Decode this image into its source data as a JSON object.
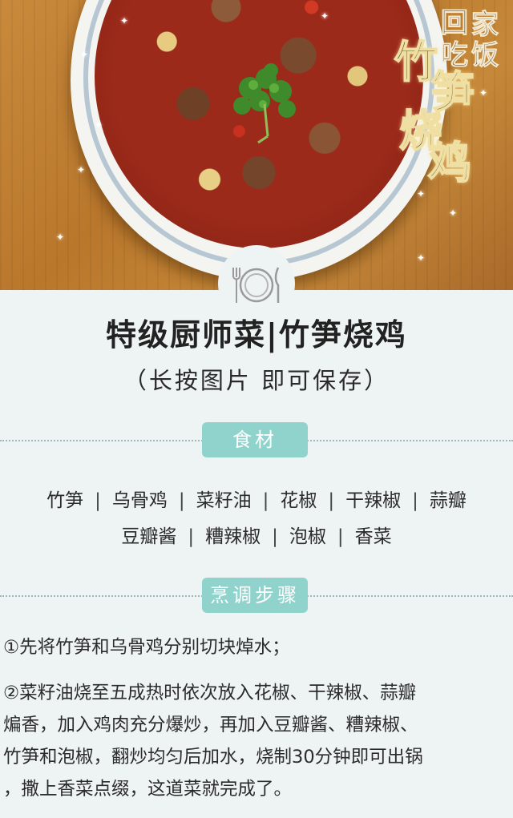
{
  "logo": {
    "chars": [
      "回",
      "家",
      "吃",
      "饭"
    ]
  },
  "hero_title": [
    "竹",
    "笋",
    "烧",
    "鸡"
  ],
  "page": {
    "title": "特级厨师菜|竹笋烧鸡",
    "subtitle": "（长按图片  即可保存）"
  },
  "ingredients": {
    "label": "食材",
    "row1": [
      "竹笋",
      "乌骨鸡",
      "菜籽油",
      "花椒",
      "干辣椒",
      "蒜瓣"
    ],
    "row2": [
      "豆瓣酱",
      "糟辣椒",
      "泡椒",
      "香菜"
    ]
  },
  "steps": {
    "label": "烹调步骤",
    "step1": "①先将竹笋和乌骨鸡分别切块焯水；",
    "step2_lines": [
      "②菜籽油烧至五成热时依次放入花椒、干辣椒、蒜瓣",
      "煸香，加入鸡肉充分爆炒，再加入豆瓣酱、糟辣椒、",
      "竹笋和泡椒，翻炒均匀后加水，烧制30分钟即可出锅",
      "，撒上香菜点缀，这道菜就完成了。"
    ]
  }
}
